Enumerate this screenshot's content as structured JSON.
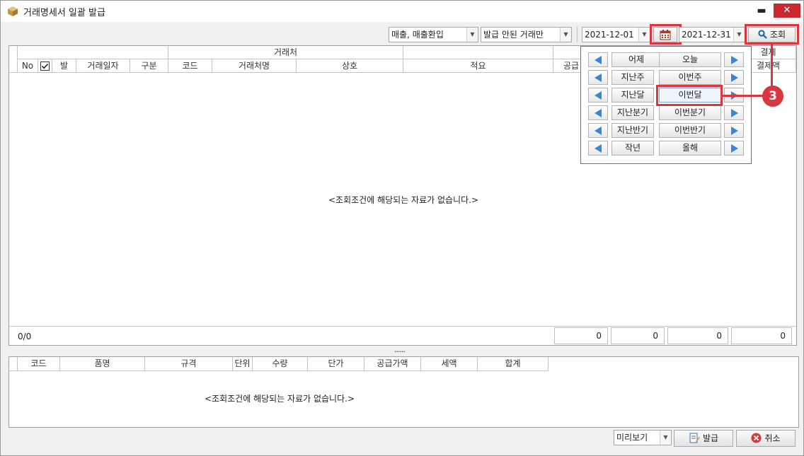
{
  "window": {
    "title": "거래명세서 일괄 발급",
    "minimize_glyph": "▬",
    "close_glyph": "✕"
  },
  "toolbar": {
    "sales_type": "매출, 매출환입",
    "issue_filter": "발급 안된 거래만",
    "date_from": "2021-12-01",
    "date_to": "2021-12-31",
    "search_label": "조회"
  },
  "main_grid": {
    "group_header": "거래처",
    "group_header_right": "결제",
    "columns": {
      "no": "No",
      "issued": "발",
      "trade_date": "거래일자",
      "type": "구분",
      "code": "코드",
      "customer_name": "거래처명",
      "company": "상호",
      "summary": "적요",
      "supply": "공급",
      "payment_amount": "결제액"
    },
    "empty_message": "<조회조건에 해당되는 자료가 없습니다.>",
    "count": "0/0",
    "totals": [
      "0",
      "0",
      "0",
      "0"
    ]
  },
  "splitter": "......",
  "detail_grid": {
    "columns": [
      "코드",
      "품명",
      "규격",
      "단위",
      "수량",
      "단가",
      "공급가액",
      "세액",
      "합계"
    ],
    "empty_message": "<조회조건에 해당되는 자료가 없습니다.>"
  },
  "footer": {
    "preview_label": "미리보기",
    "issue_label": "발급",
    "cancel_label": "취소"
  },
  "date_popup": {
    "rows": [
      {
        "left": "어제",
        "right": "오늘"
      },
      {
        "left": "지난주",
        "right": "이번주"
      },
      {
        "left": "지난달",
        "right": "이번달"
      },
      {
        "left": "지난분기",
        "right": "이번분기"
      },
      {
        "left": "지난반기",
        "right": "이번반기"
      },
      {
        "left": "작년",
        "right": "올해"
      }
    ]
  },
  "annotation": {
    "step": "3"
  },
  "colors": {
    "highlight": "#d9373f",
    "arrow": "#3a86d6"
  }
}
